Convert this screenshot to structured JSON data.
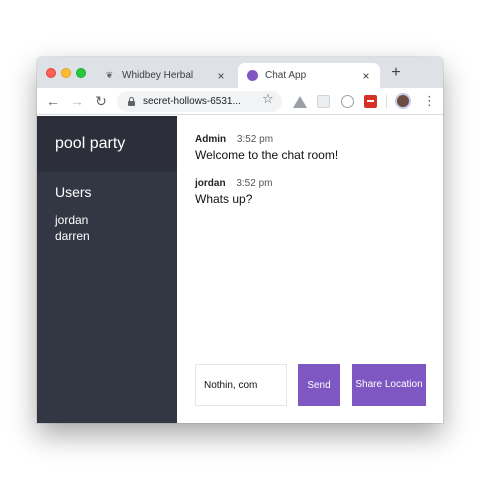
{
  "browser": {
    "tabs": [
      {
        "title": "Whidbey Herbal",
        "icon": "leaf-icon"
      },
      {
        "title": "Chat App",
        "icon": "purple-dot-icon",
        "active": true
      }
    ],
    "tab_close_glyph": "×",
    "new_tab_glyph": "+",
    "url": "secret-hollows-6531...",
    "extensions": [
      "drive-icon",
      "box-icon",
      "clock-icon",
      "red-extension-icon"
    ]
  },
  "sidebar": {
    "room": "pool party",
    "users_heading": "Users",
    "users": [
      "jordan",
      "darren"
    ]
  },
  "messages": [
    {
      "name": "Admin",
      "time": "3:52 pm",
      "text": "Welcome to the chat room!"
    },
    {
      "name": "jordan",
      "time": "3:52 pm",
      "text": "Whats up?"
    }
  ],
  "composer": {
    "input_value": "Nothin, com",
    "send_label": "Send",
    "share_label": "Share Location"
  },
  "colors": {
    "accent": "#7e57c2",
    "sidebar_bg": "#333744",
    "sidebar_header_bg": "#2c2f3a"
  }
}
